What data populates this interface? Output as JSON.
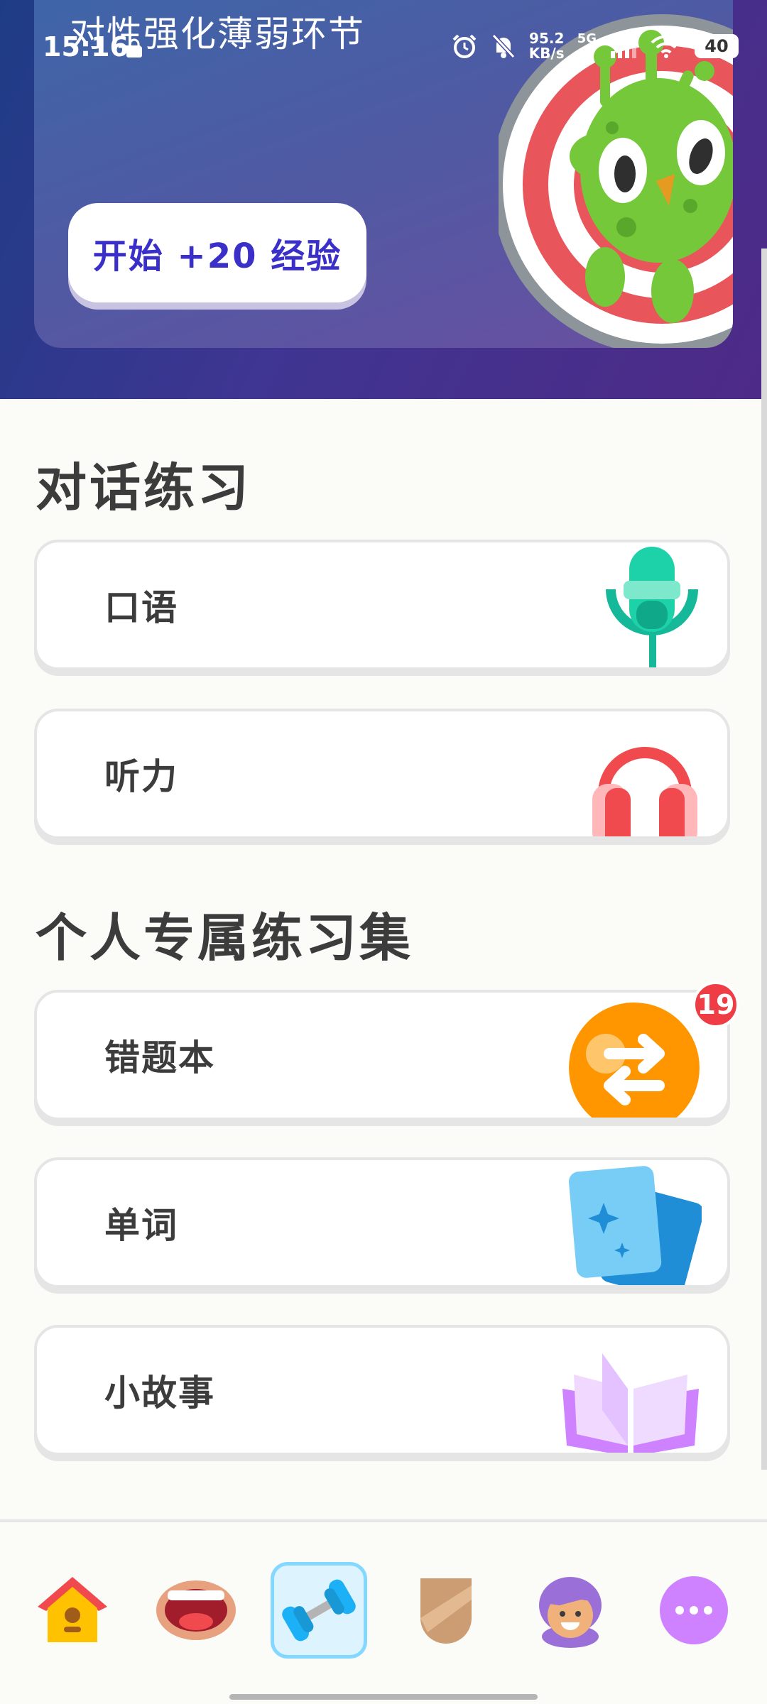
{
  "status_bar": {
    "time": "15:16",
    "net_speed_value": "95.2",
    "net_speed_unit": "KB/s",
    "network_gen": "5G",
    "battery": "40"
  },
  "hero": {
    "title": "对性强化薄弱环节",
    "start_button": "开始 +20 经验"
  },
  "conversation": {
    "title": "对话练习",
    "items": [
      {
        "label": "口语",
        "icon": "microphone-icon"
      },
      {
        "label": "听力",
        "icon": "headphones-icon"
      }
    ]
  },
  "personal": {
    "title": "个人专属练习集",
    "items": [
      {
        "label": "错题本",
        "icon": "mistakes-review-icon",
        "badge": "19"
      },
      {
        "label": "单词",
        "icon": "word-cards-icon"
      },
      {
        "label": "小故事",
        "icon": "story-book-icon"
      }
    ]
  },
  "bottom_nav": {
    "items": [
      {
        "name": "home",
        "icon": "birdhouse-icon"
      },
      {
        "name": "speak",
        "icon": "mouth-icon"
      },
      {
        "name": "practice",
        "icon": "dumbbell-icon",
        "active": true
      },
      {
        "name": "leagues",
        "icon": "shield-icon"
      },
      {
        "name": "profile",
        "icon": "avatar-icon"
      },
      {
        "name": "more",
        "icon": "more-dots-icon"
      }
    ]
  },
  "colors": {
    "accent_blue": "#3a2fc8",
    "badge_red": "#ee3d44",
    "active_nav_bg": "#ddf3fd",
    "active_nav_border": "#84d8ff"
  }
}
